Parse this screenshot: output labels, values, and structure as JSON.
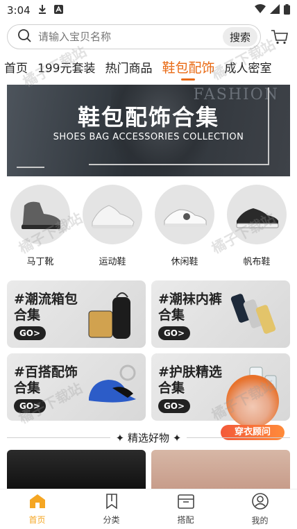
{
  "status_bar": {
    "time": "3:04"
  },
  "search": {
    "placeholder": "请输入宝贝名称",
    "button_label": "搜索"
  },
  "tabs": [
    {
      "label": "首页",
      "active": false
    },
    {
      "label": "199元套装",
      "active": false
    },
    {
      "label": "热门商品",
      "active": false
    },
    {
      "label": "鞋包配饰",
      "active": true
    },
    {
      "label": "成人密室",
      "active": false
    }
  ],
  "banner": {
    "title": "鞋包配饰合集",
    "subtitle": "SHOES BAG ACCESSORIES COLLECTION",
    "bg_text": "FASHION"
  },
  "categories": [
    {
      "label": "马丁靴"
    },
    {
      "label": "运动鞋"
    },
    {
      "label": "休闲鞋"
    },
    {
      "label": "帆布鞋"
    }
  ],
  "collections": [
    {
      "title": "#潮流箱包合集",
      "go": "GO>"
    },
    {
      "title": "#潮袜内裤合集",
      "go": "GO>"
    },
    {
      "title": "#百搭配饰合集",
      "go": "GO>"
    },
    {
      "title": "#护肤精选合集",
      "go": "GO>"
    }
  ],
  "section": {
    "title": "✦ 精选好物 ✦"
  },
  "float_tag": "穿衣顾问",
  "watermark": "橘子下载站",
  "bottom_nav": [
    {
      "label": "首页",
      "icon": "home-icon",
      "active": true
    },
    {
      "label": "分类",
      "icon": "bookmark-icon",
      "active": false
    },
    {
      "label": "搭配",
      "icon": "box-icon",
      "active": false
    },
    {
      "label": "我的",
      "icon": "user-icon",
      "active": false
    }
  ],
  "colors": {
    "accent": "#e96a14",
    "nav_active": "#f5a623"
  }
}
